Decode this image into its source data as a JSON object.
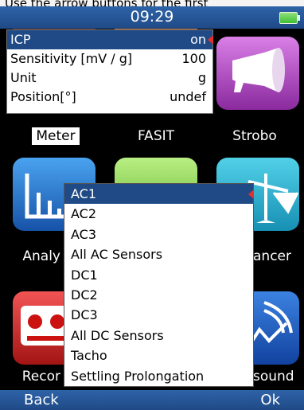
{
  "hint_text": "Use the arrow buttons for the first",
  "status": {
    "time": "09:29"
  },
  "settings": [
    {
      "label": "ICP",
      "value": "on"
    },
    {
      "label": "Sensitivity [mV / g]",
      "value": "100"
    },
    {
      "label": "Unit",
      "value": "g"
    },
    {
      "label": "Position[°]",
      "value": "undef"
    }
  ],
  "tiles": {
    "meter": "Meter",
    "fasit": "FASIT",
    "strobo": "Strobo",
    "analyzer": "Analy",
    "balancer": "ancer",
    "recorder": "Recor",
    "ultrasound": "sound"
  },
  "dropdown": [
    "AC1",
    "AC2",
    "AC3",
    "All AC Sensors",
    "DC1",
    "DC2",
    "DC3",
    "All DC Sensors",
    "Tacho",
    "Settling Prolongation"
  ],
  "softkeys": {
    "left": "Back",
    "right": "Ok"
  },
  "colors": {
    "accent": "#1f4a86",
    "marker": "#e53030",
    "battery": "#3cbf35"
  }
}
